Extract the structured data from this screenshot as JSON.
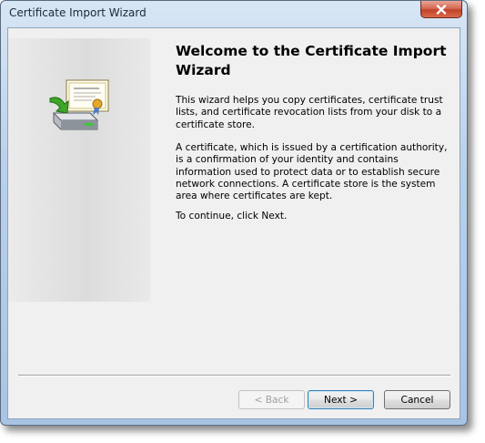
{
  "window": {
    "title": "Certificate Import Wizard"
  },
  "titlebar": {
    "close_icon": "close-icon"
  },
  "wizard": {
    "illustration_icon": "certificate-import-icon",
    "heading": "Welcome to the Certificate Import Wizard",
    "paragraphs": [
      "This wizard helps you copy certificates, certificate trust lists, and certificate revocation lists from your disk to a certificate store.",
      "A certificate, which is issued by a certification authority, is a confirmation of your identity and contains information used to protect data or to establish secure network connections. A certificate store is the system area where certificates are kept.",
      "To continue, click Next."
    ]
  },
  "buttons": {
    "back_label": "< Back",
    "next_label": "Next >",
    "cancel_label": "Cancel"
  },
  "colors": {
    "close_button": "#c2432a",
    "default_button_border": "#3c7fb1",
    "disabled_text": "#a0a0a0"
  }
}
